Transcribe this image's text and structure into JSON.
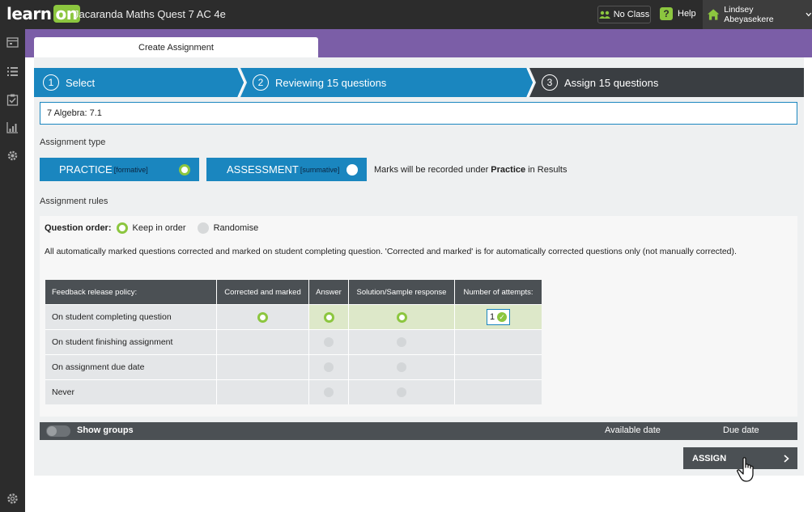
{
  "header": {
    "logo_learn": "learn",
    "logo_on": "on",
    "app_title": "Jacaranda Maths Quest 7 AC 4e",
    "no_class": "No Class",
    "help": "Help",
    "user_name": "Lindsey Abeyasekere"
  },
  "sidebar": {
    "icons": [
      "calendar-icon",
      "list-icon",
      "checklist-icon",
      "chart-icon",
      "settings-cog-icon",
      "gear-icon"
    ]
  },
  "tab": {
    "label": "Create Assignment"
  },
  "steps": [
    {
      "number": "1",
      "label": "Select"
    },
    {
      "number": "2",
      "label": "Reviewing 15 questions"
    },
    {
      "number": "3",
      "label": "Assign 15 questions"
    }
  ],
  "selection": {
    "value": "7 Algebra: 7.1"
  },
  "assignment_type": {
    "heading": "Assignment type",
    "practice_label": "PRACTICE",
    "practice_sub": "[formative]",
    "assessment_label": "ASSESSMENT",
    "assessment_sub": "[summative]",
    "note_prefix": "Marks will be recorded under",
    "note_bold": "Practice",
    "note_suffix": "in Results"
  },
  "rules": {
    "heading": "Assignment rules",
    "question_order_label": "Question order:",
    "keep_in_order": "Keep in order",
    "randomise": "Randomise",
    "auto_note": "All automatically marked questions corrected and marked on student completing question. 'Corrected and marked' is for automatically corrected questions only (not manually corrected)."
  },
  "feedback_table": {
    "headers": [
      "Feedback release policy:",
      "Corrected and marked",
      "Answer",
      "Solution/Sample response",
      "Number of attempts:"
    ],
    "rows": [
      {
        "label": "On student completing question"
      },
      {
        "label": "On student finishing assignment"
      },
      {
        "label": "On assignment due date"
      },
      {
        "label": "Never"
      }
    ],
    "attempts_value": "1"
  },
  "groups": {
    "show_groups": "Show groups",
    "available_date": "Available date",
    "due_date": "Due date"
  },
  "assign_button": {
    "label": "ASSIGN"
  },
  "colors": {
    "accent_blue": "#1a86bf",
    "brand_green": "#8cc63f",
    "header_purple": "#7b5ea7",
    "dark_bar": "#2c2c2c"
  }
}
